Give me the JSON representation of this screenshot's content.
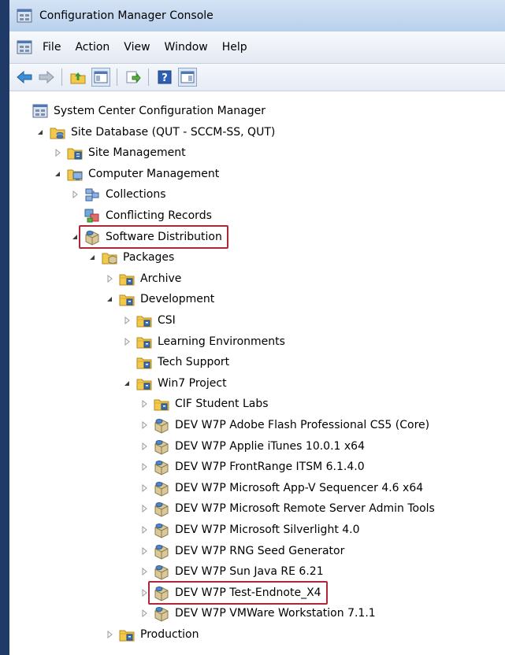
{
  "window": {
    "title": "Configuration Manager Console"
  },
  "menu": [
    "File",
    "Action",
    "View",
    "Window",
    "Help"
  ],
  "toolbar": [
    "back",
    "forward",
    "up-folder",
    "show-hide-tree",
    "export-list",
    "help",
    "console-tree"
  ],
  "tree": [
    {
      "label": "System Center Configuration Manager",
      "level": 0,
      "expander": "none",
      "icon": "console"
    },
    {
      "label": "Site Database  (QUT - SCCM-SS, QUT)",
      "level": 1,
      "expander": "expanded",
      "icon": "database"
    },
    {
      "label": "Site Management",
      "level": 2,
      "expander": "collapsed",
      "icon": "site"
    },
    {
      "label": "Computer Management",
      "level": 2,
      "expander": "expanded",
      "icon": "computer"
    },
    {
      "label": "Collections",
      "level": 3,
      "expander": "collapsed",
      "icon": "collections"
    },
    {
      "label": "Conflicting Records",
      "level": 3,
      "expander": "none",
      "icon": "conflict"
    },
    {
      "label": "Software Distribution",
      "level": 3,
      "expander": "expanded",
      "icon": "package",
      "highlight": true
    },
    {
      "label": "Packages",
      "level": 4,
      "expander": "expanded",
      "icon": "folder-box"
    },
    {
      "label": "Archive",
      "level": 5,
      "expander": "collapsed",
      "icon": "folder"
    },
    {
      "label": "Development",
      "level": 5,
      "expander": "expanded",
      "icon": "folder"
    },
    {
      "label": "CSI",
      "level": 6,
      "expander": "collapsed",
      "icon": "folder"
    },
    {
      "label": "Learning Environments",
      "level": 6,
      "expander": "collapsed",
      "icon": "folder"
    },
    {
      "label": "Tech Support",
      "level": 6,
      "expander": "none",
      "icon": "folder"
    },
    {
      "label": "Win7 Project",
      "level": 6,
      "expander": "expanded",
      "icon": "folder"
    },
    {
      "label": "CIF Student Labs",
      "level": 7,
      "expander": "collapsed",
      "icon": "folder"
    },
    {
      "label": "DEV W7P Adobe Flash Professional CS5 (Core)",
      "level": 7,
      "expander": "collapsed",
      "icon": "package"
    },
    {
      "label": "DEV W7P Applie iTunes 10.0.1 x64",
      "level": 7,
      "expander": "collapsed",
      "icon": "package"
    },
    {
      "label": "DEV W7P FrontRange ITSM 6.1.4.0",
      "level": 7,
      "expander": "collapsed",
      "icon": "package"
    },
    {
      "label": "DEV W7P Microsoft App-V Sequencer 4.6 x64",
      "level": 7,
      "expander": "collapsed",
      "icon": "package"
    },
    {
      "label": "DEV W7P Microsoft Remote Server Admin Tools",
      "level": 7,
      "expander": "collapsed",
      "icon": "package"
    },
    {
      "label": "DEV W7P Microsoft Silverlight 4.0",
      "level": 7,
      "expander": "collapsed",
      "icon": "package"
    },
    {
      "label": "DEV W7P RNG Seed Generator",
      "level": 7,
      "expander": "collapsed",
      "icon": "package"
    },
    {
      "label": "DEV W7P Sun Java RE 6.21",
      "level": 7,
      "expander": "collapsed",
      "icon": "package"
    },
    {
      "label": "DEV W7P Test-Endnote_X4",
      "level": 7,
      "expander": "collapsed",
      "icon": "package",
      "highlight": true
    },
    {
      "label": "DEV W7P VMWare Workstation 7.1.1",
      "level": 7,
      "expander": "collapsed",
      "icon": "package"
    },
    {
      "label": "Production",
      "level": 5,
      "expander": "collapsed",
      "icon": "folder"
    }
  ],
  "colors": {
    "highlight_border": "#b0273a",
    "folder": "#f2c94c",
    "folder_badge": "#3a6fb7",
    "window_edge": "#1f3a66"
  }
}
